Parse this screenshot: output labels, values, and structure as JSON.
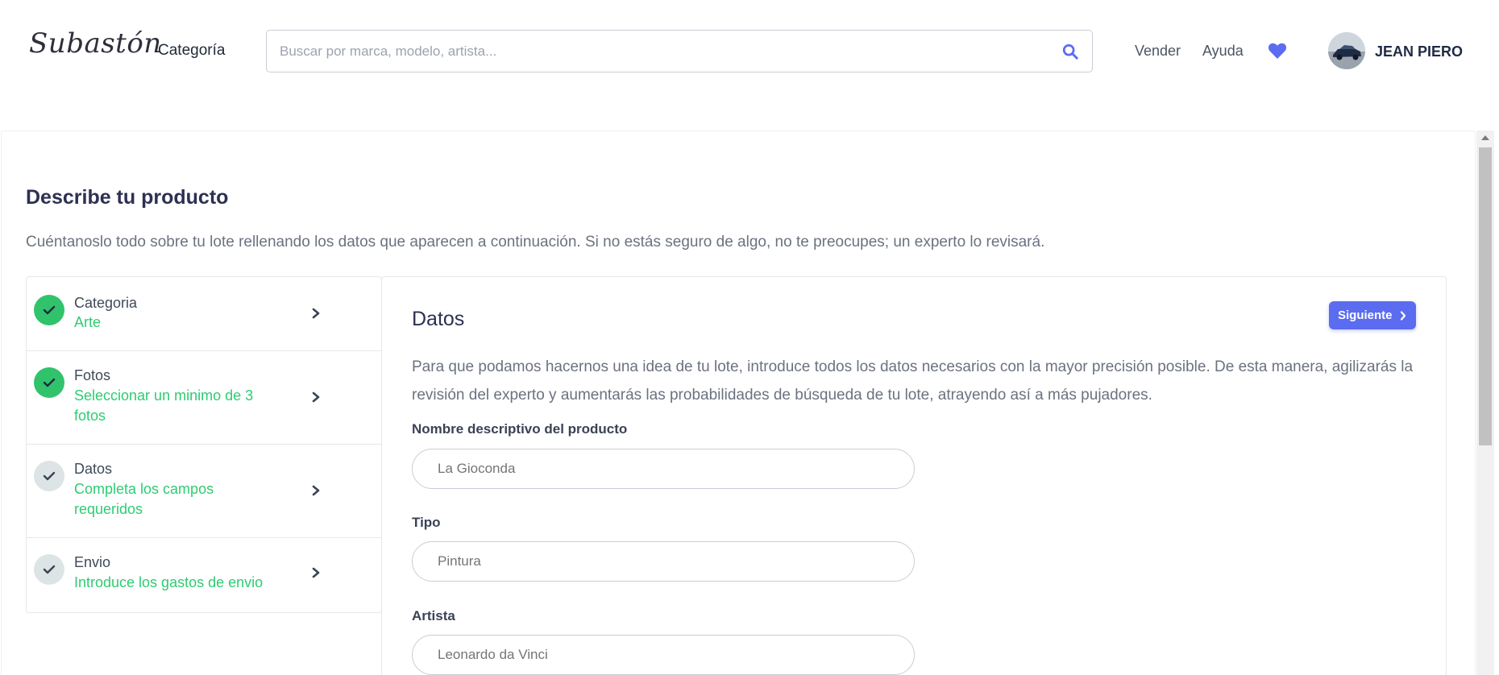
{
  "header": {
    "logo": "Subastón",
    "categoria": "Categoría",
    "search_placeholder": "Buscar por marca, modelo, artista...",
    "vender": "Vender",
    "ayuda": "Ayuda",
    "username": "JEAN PIERO"
  },
  "page": {
    "title": "Describe tu producto",
    "subtitle": "Cuéntanoslo todo sobre tu lote rellenando los datos que aparecen a continuación. Si no estás seguro de algo, no te preocupes; un experto lo revisará."
  },
  "steps": [
    {
      "name": "Categoria",
      "status": "Arte",
      "state": "done"
    },
    {
      "name": "Fotos",
      "status": "Seleccionar un minimo de 3 fotos",
      "state": "done"
    },
    {
      "name": "Datos",
      "status": "Completa los campos requeridos",
      "state": "pending"
    },
    {
      "name": "Envio",
      "status": "Introduce los gastos de envio",
      "state": "pending"
    }
  ],
  "form": {
    "title": "Datos",
    "next_label": "Siguiente",
    "description": "Para que podamos hacernos una idea de tu lote, introduce todos los datos necesarios con la mayor precisión posible. De esta manera, agilizarás la revisión del experto y aumentarás las probabilidades de búsqueda de tu lote, atrayendo así a más pujadores.",
    "fields": [
      {
        "label": "Nombre descriptivo del producto",
        "placeholder": "La Gioconda"
      },
      {
        "label": "Tipo",
        "placeholder": "Pintura"
      },
      {
        "label": "Artista",
        "placeholder": "Leonardo da Vinci"
      }
    ]
  },
  "colors": {
    "accent": "#5b6cf0",
    "success": "#2ecc71",
    "heading": "#2d3052"
  },
  "icons": [
    "search-icon",
    "heart-icon",
    "check-icon",
    "chevron-right-icon"
  ]
}
